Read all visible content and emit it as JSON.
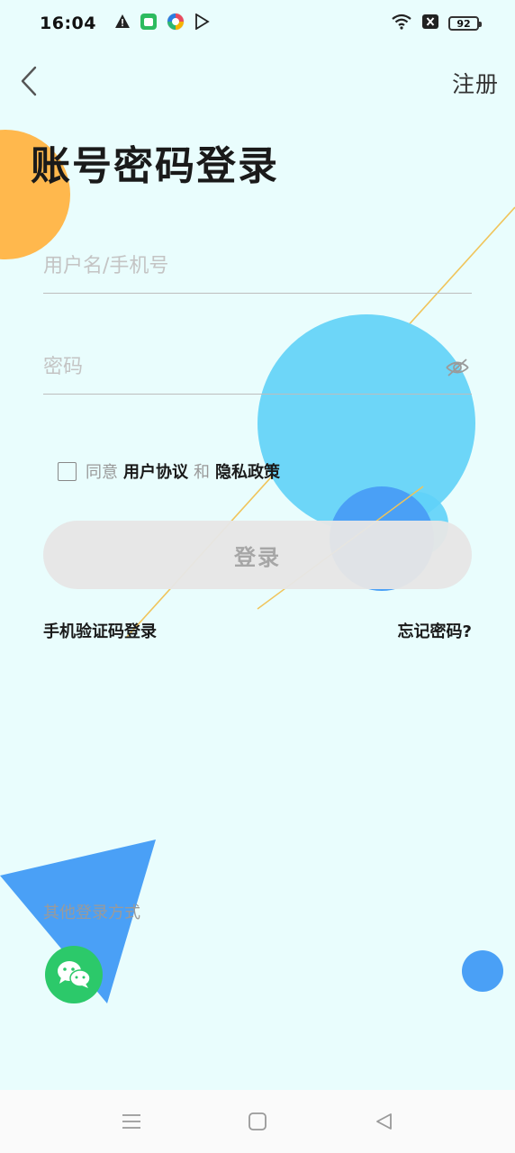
{
  "status_bar": {
    "time": "16:04",
    "battery": "92",
    "left_icons": [
      "warning-icon",
      "green-app-icon",
      "multicolor-app-icon",
      "play-store-icon"
    ],
    "right_icons": [
      "wifi-icon",
      "x-box-icon",
      "battery-icon"
    ]
  },
  "header": {
    "back_icon": "chevron-left-icon",
    "register_label": "注册",
    "title": "账号密码登录"
  },
  "form": {
    "username_placeholder": "用户名/手机号",
    "username_value": "",
    "password_placeholder": "密码",
    "password_value": "",
    "password_toggle_icon": "eye-off-icon"
  },
  "agreement": {
    "checked": false,
    "prefix": "同意",
    "user_agreement": "用户协议",
    "joiner": "和",
    "privacy_policy": "隐私政策"
  },
  "login_button_label": "登录",
  "links": {
    "sms_login": "手机验证码登录",
    "forgot_password": "忘记密码?"
  },
  "other_login": {
    "label": "其他登录方式",
    "wechat_icon": "wechat-icon"
  },
  "nav": {
    "menu_icon": "menu-icon",
    "home_icon": "square-icon",
    "back_icon": "triangle-back-icon"
  },
  "colors": {
    "background": "#e9fdfd",
    "orange_deco": "#ffb84d",
    "light_blue_deco": "#6dd6f8",
    "blue_deco": "#4aa0f6",
    "wechat_green": "#2cc96a"
  }
}
